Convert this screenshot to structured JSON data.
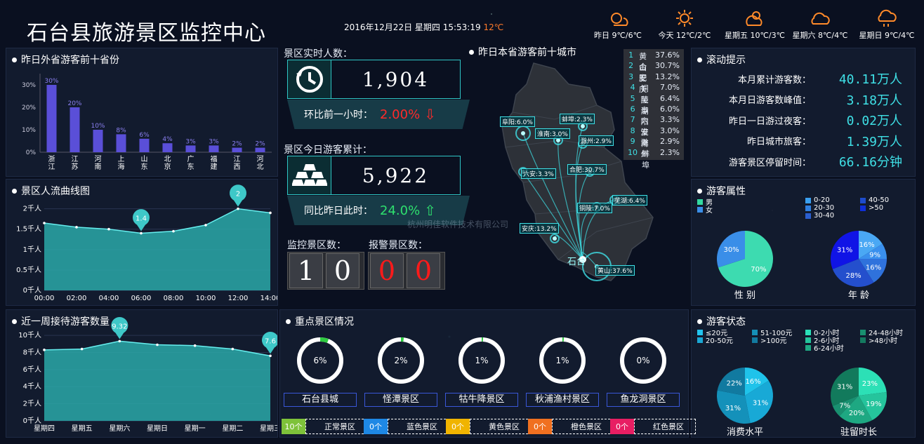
{
  "header": {
    "title": "石台县旅游景区监控中心",
    "datetime": "2016年12月22日 星期四 15:53:19",
    "temp": "12℃",
    "weather": [
      {
        "label": "昨日 9℃/6℃",
        "icon": "partly-sunny-icon"
      },
      {
        "label": "今天 12℃/2℃",
        "icon": "sun-icon"
      },
      {
        "label": "星期五 10℃/3℃",
        "icon": "partly-cloudy-icon"
      },
      {
        "label": "星期六 8℃/4℃",
        "icon": "cloud-icon"
      },
      {
        "label": "星期日 9℃/4℃",
        "icon": "rain-cloud-icon"
      }
    ]
  },
  "provinces": {
    "title": "昨日外省游客前十省份",
    "chart_data": {
      "type": "bar",
      "categories": [
        "浙江",
        "江苏",
        "河南",
        "上海",
        "山东",
        "北京",
        "广东",
        "福建",
        "江西",
        "河北"
      ],
      "values": [
        30,
        20,
        10,
        8,
        6,
        4,
        3,
        3,
        2,
        2
      ],
      "labels": [
        "30%",
        "20%",
        "10%",
        "8%",
        "6%",
        "4%",
        "3%",
        "3%",
        "2%",
        "2%"
      ],
      "yticks": [
        "0%",
        "10%",
        "20%",
        "30%"
      ],
      "ylim": [
        0,
        35
      ]
    }
  },
  "flow": {
    "title": "景区人流曲线图",
    "chart_data": {
      "type": "area",
      "x": [
        "00:00",
        "02:00",
        "04:00",
        "06:00",
        "08:00",
        "10:00",
        "12:00",
        "14:00"
      ],
      "values": [
        1.65,
        1.55,
        1.5,
        1.4,
        1.45,
        1.6,
        2.0,
        1.9
      ],
      "yticks": [
        "0千人",
        "0.5千人",
        "1千人",
        "1.5千人",
        "2千人"
      ],
      "ylim": [
        0,
        2.2
      ],
      "markers": [
        {
          "label": "1.4",
          "index": 3
        },
        {
          "label": "2",
          "index": 6
        }
      ]
    }
  },
  "week": {
    "title": "近一周接待游客数量",
    "chart_data": {
      "type": "area",
      "x": [
        "星期四",
        "星期五",
        "星期六",
        "星期日",
        "星期一",
        "星期二",
        "星期三"
      ],
      "values": [
        8.3,
        8.4,
        9.32,
        8.9,
        8.8,
        8.4,
        7.6
      ],
      "yticks": [
        "0千人",
        "2千人",
        "4千人",
        "6千人",
        "8千人",
        "10千人"
      ],
      "ylim": [
        0,
        10.5
      ],
      "markers": [
        {
          "label": "9.32",
          "index": 2
        },
        {
          "label": "7.6",
          "index": 6
        }
      ]
    }
  },
  "realtime": {
    "title": "景区实时人数：",
    "value": "1,904",
    "cmp_label": "环比前一小时：",
    "cmp_value": "2.00%",
    "cmp_arrow": "⇩"
  },
  "today": {
    "title": "景区今日游客累计：",
    "value": "5,922",
    "cmp_label": "同比昨日此时：",
    "cmp_value": "24.0%",
    "cmp_arrow": "⇧"
  },
  "counts": {
    "monitor_label": "监控景区数：",
    "monitor_digits": [
      "1",
      "0"
    ],
    "alarm_label": "报警景区数：",
    "alarm_digits": [
      "0",
      "0"
    ]
  },
  "map": {
    "title": "昨日本省游客前十城市",
    "origin": "石台",
    "ranking": [
      {
        "n": "1",
        "city": "黄山",
        "pct": "37.6%"
      },
      {
        "n": "2",
        "city": "合肥",
        "pct": "30.7%"
      },
      {
        "n": "3",
        "city": "安庆",
        "pct": "13.2%"
      },
      {
        "n": "4",
        "city": "铜陵",
        "pct": "7.0%"
      },
      {
        "n": "5",
        "city": "芜湖",
        "pct": "6.4%"
      },
      {
        "n": "6",
        "city": "阜阳",
        "pct": "6.0%"
      },
      {
        "n": "7",
        "city": "六安",
        "pct": "3.3%"
      },
      {
        "n": "8",
        "city": "淮南",
        "pct": "3.0%"
      },
      {
        "n": "9",
        "city": "滁州",
        "pct": "2.9%"
      },
      {
        "n": "10",
        "city": "蚌埠",
        "pct": "2.3%"
      }
    ],
    "labels": [
      "阜阳:6.0%",
      "蚌埠:2.3%",
      "淮南:3.0%",
      "滁州:2.9%",
      "六安:3.3%",
      "合肥:30.7%",
      "芜湖:6.4%",
      "铜陵:7.0%",
      "安庆:13.2%",
      "黄山:37.6%"
    ]
  },
  "watermark": "杭州明佳软件技术有限公司",
  "scroll": {
    "title": "滚动提示",
    "items": [
      {
        "k": "本月累计游客数：",
        "v": "40.11万人"
      },
      {
        "k": "本月日游客数峰值：",
        "v": "3.18万人"
      },
      {
        "k": "昨日一日游过夜客：",
        "v": "0.02万人"
      },
      {
        "k": "昨日城市旅客：",
        "v": "1.39万人"
      },
      {
        "k": "游客景区停留时间：",
        "v": "66.16分钟"
      }
    ]
  },
  "attributes": {
    "title": "游客属性",
    "gender_legend": [
      {
        "label": "男",
        "color": "#33d9a0"
      },
      {
        "label": "女",
        "color": "#3a8ee8"
      }
    ],
    "age_legend": [
      {
        "label": "0-20",
        "color": "#3aa0f0"
      },
      {
        "label": "20-30",
        "color": "#2f7fe0"
      },
      {
        "label": "30-40",
        "color": "#2a5ecf"
      },
      {
        "label": "40-50",
        "color": "#1e4ccc"
      },
      {
        "label": ">50",
        "color": "#0f2fd8"
      }
    ],
    "gender_pie": {
      "label": "性 别",
      "slices": [
        {
          "v": 70,
          "t": "70%",
          "c": "#3ddbb0"
        },
        {
          "v": 30,
          "t": "30%",
          "c": "#3a8ee8"
        }
      ]
    },
    "age_pie": {
      "label": "年 龄",
      "slices": [
        {
          "v": 16,
          "t": "16%",
          "c": "#4aa8f4"
        },
        {
          "v": 9,
          "t": "9%",
          "c": "#3a90ee"
        },
        {
          "v": 16,
          "t": "16%",
          "c": "#2f72dc"
        },
        {
          "v": 28,
          "t": "28%",
          "c": "#244fcd"
        },
        {
          "v": 31,
          "t": "31%",
          "c": "#1014e6"
        }
      ]
    }
  },
  "status": {
    "title": "游客状态",
    "spend_legend": [
      {
        "label": "≤20元",
        "color": "#22c4ee"
      },
      {
        "label": "20-50元",
        "color": "#1aa7d4"
      },
      {
        "label": "51-100元",
        "color": "#1590b8"
      },
      {
        "label": ">100元",
        "color": "#127aa0"
      }
    ],
    "stay_legend": [
      {
        "label": "0-2小时",
        "color": "#2be0b8"
      },
      {
        "label": "2-6小时",
        "color": "#24c49c"
      },
      {
        "label": "6-24小时",
        "color": "#1eaa84"
      },
      {
        "label": "24-48小时",
        "color": "#199070"
      },
      {
        "label": ">48小时",
        "color": "#147a60"
      }
    ],
    "spend_pie": {
      "label": "消费水平",
      "slices": [
        {
          "v": 16,
          "t": "16%",
          "c": "#1fc3ea"
        },
        {
          "v": 31,
          "t": "31%",
          "c": "#18a9d6"
        },
        {
          "v": 31,
          "t": "31%",
          "c": "#1491ba"
        },
        {
          "v": 22,
          "t": "22%",
          "c": "#117aa0"
        }
      ]
    },
    "stay_pie": {
      "label": "驻留时长",
      "slices": [
        {
          "v": 23,
          "t": "23%",
          "c": "#2ce0b6"
        },
        {
          "v": 19,
          "t": "19%",
          "c": "#25c49c"
        },
        {
          "v": 20,
          "t": "20%",
          "c": "#1ea882"
        },
        {
          "v": 7,
          "t": "7%",
          "c": "#199070"
        },
        {
          "v": 31,
          "t": "31%",
          "c": "#127a5c"
        }
      ]
    }
  },
  "scenic": {
    "title": "重点景区情况",
    "rings": [
      {
        "name": "石台县城",
        "pct": 6,
        "t": "6%"
      },
      {
        "name": "怪潭景区",
        "pct": 2,
        "t": "2%"
      },
      {
        "name": "牯牛降景区",
        "pct": 1,
        "t": "1%"
      },
      {
        "name": "秋浦渔村景区",
        "pct": 1,
        "t": "1%"
      },
      {
        "name": "鱼龙洞景区",
        "pct": 0,
        "t": "0%"
      }
    ],
    "statuses": [
      {
        "count": "10个",
        "label": "正常景区",
        "color": "#7ec23a"
      },
      {
        "count": "0个",
        "label": "蓝色景区",
        "color": "#1e88e5"
      },
      {
        "count": "0个",
        "label": "黄色景区",
        "color": "#f0b400"
      },
      {
        "count": "0个",
        "label": "橙色景区",
        "color": "#f07020"
      },
      {
        "count": "0个",
        "label": "红色景区",
        "color": "#e81e63"
      }
    ]
  }
}
